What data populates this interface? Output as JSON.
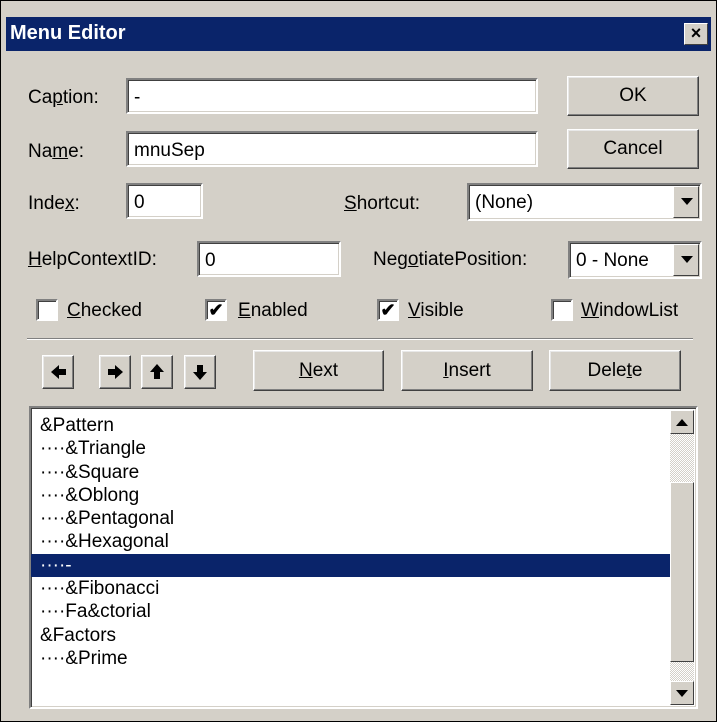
{
  "window": {
    "title": "Menu Editor",
    "close_glyph": "×"
  },
  "fields": {
    "caption": {
      "label_pre": "Ca",
      "label_key": "p",
      "label_post": "tion:",
      "value": "-"
    },
    "name": {
      "label_pre": "Na",
      "label_key": "m",
      "label_post": "e:",
      "value": "mnuSep"
    },
    "index": {
      "label_pre": "Inde",
      "label_key": "x",
      "label_post": ":",
      "value": "0"
    },
    "shortcut": {
      "label_pre": "",
      "label_key": "S",
      "label_post": "hortcut:",
      "value": "(None)"
    },
    "helpcontext": {
      "label_pre": "",
      "label_key": "H",
      "label_post": "elpContextID:",
      "value": "0"
    },
    "negotiate": {
      "label_pre": "Neg",
      "label_key": "o",
      "label_post": "tiatePosition:",
      "value": "0 - None"
    }
  },
  "checkboxes": [
    {
      "key": "C",
      "rest": "hecked",
      "checked": false,
      "mark": ""
    },
    {
      "key": "E",
      "rest": "nabled",
      "checked": true,
      "mark": "✔"
    },
    {
      "key": "V",
      "rest": "isible",
      "checked": true,
      "mark": "✔"
    },
    {
      "key": "W",
      "rest": "indowList",
      "checked": false,
      "mark": ""
    }
  ],
  "buttons": {
    "ok": "OK",
    "cancel": "Cancel",
    "next": {
      "key": "N",
      "rest": "ext"
    },
    "insert": {
      "key": "I",
      "rest": "nsert"
    },
    "delete": {
      "pre": "Dele",
      "key": "t",
      "post": "e"
    }
  },
  "arrows": [
    "left-arrow-icon",
    "right-arrow-icon",
    "up-arrow-icon",
    "down-arrow-icon"
  ],
  "menu_list": {
    "selected_index": 6,
    "items": [
      "&Pattern",
      "····&Triangle",
      "····&Square",
      "····&Oblong",
      "····&Pentagonal",
      "····&Hexagonal",
      "····-",
      "····&Fibonacci",
      "····Fa&ctorial",
      "&Factors",
      "····&Prime"
    ]
  },
  "colors": {
    "face": "#d4d0c8",
    "titlebar": "#0a246a",
    "selection": "#0a246a"
  }
}
